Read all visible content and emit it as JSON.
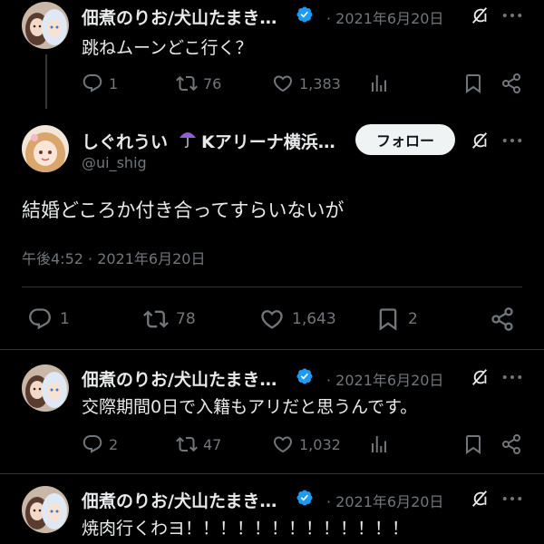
{
  "tweets": [
    {
      "name": "佃煮のりお/犬山たまき…",
      "time": "· 2021年6月20日",
      "text": "跳ねムーンどこ行く？",
      "replies": "1",
      "retweets": "76",
      "likes": "1,383"
    },
    {
      "name": "佃煮のりお/犬山たまき…",
      "time": "· 2021年6月20日",
      "text": "交際期間0日で入籍もアリだと思うんです。",
      "replies": "2",
      "retweets": "47",
      "likes": "1,032"
    },
    {
      "name": "佃煮のりお/犬山たまき…",
      "time": "· 2021年6月20日",
      "text": "焼肉行くわヨ！！！！！！！！！！！！！"
    }
  ],
  "main_tweet": {
    "name": "しぐれうい",
    "name_suffix": "Kアリーナ横浜…",
    "handle": "@ui_shig",
    "follow_label": "フォロー",
    "text": "結婚どころか付き合ってすらいないが",
    "timestamp": "午後4:52 · 2021年6月20日",
    "replies": "1",
    "retweets": "78",
    "likes": "1,643",
    "bookmarks": "2"
  },
  "colors": {
    "background": "#000000",
    "text_primary": "#e7e9ea",
    "text_secondary": "#71767b",
    "verified": "#1d9bf0",
    "follow_bg": "#eff3f4",
    "divider": "#2f3336"
  },
  "icons": [
    "reply-icon",
    "retweet-icon",
    "like-icon",
    "views-icon",
    "bookmark-icon",
    "share-icon",
    "verified-icon",
    "grok-icon",
    "more-icon",
    "umbrella-icon"
  ]
}
